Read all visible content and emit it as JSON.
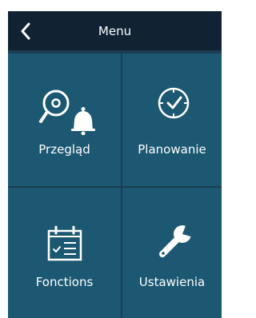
{
  "header": {
    "title": "Menu",
    "back_icon": "chevron-left-icon"
  },
  "tiles": [
    {
      "label": "Przegląd",
      "icon": "search-bell-icon"
    },
    {
      "label": "Planowanie",
      "icon": "clock-icon"
    },
    {
      "label": "Fonctions",
      "icon": "calendar-checklist-icon"
    },
    {
      "label": "Ustawienia",
      "icon": "wrench-icon"
    }
  ],
  "colors": {
    "header_bg": "#112333",
    "screen_bg": "#1c3d52",
    "tile_bg": "#1c5871",
    "foreground": "#ffffff"
  }
}
